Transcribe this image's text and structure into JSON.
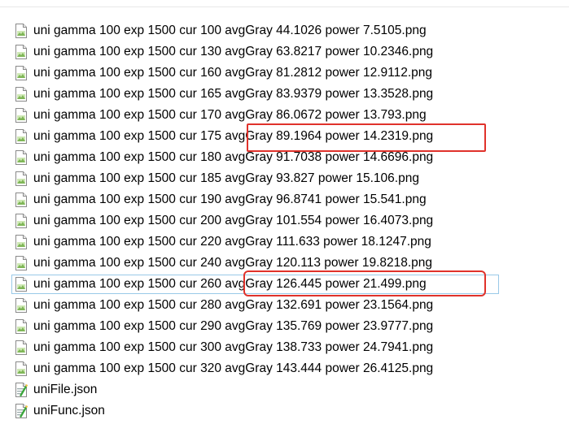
{
  "files": [
    {
      "name": "uni gamma 100 exp 1500 cur 100 avgGray 44.1026 power 7.5105.png",
      "icon": "png-file-icon"
    },
    {
      "name": "uni gamma 100 exp 1500 cur 130 avgGray 63.8217 power 10.2346.png",
      "icon": "png-file-icon"
    },
    {
      "name": "uni gamma 100 exp 1500 cur 160 avgGray 81.2812 power 12.9112.png",
      "icon": "png-file-icon"
    },
    {
      "name": "uni gamma 100 exp 1500 cur 165 avgGray 83.9379 power 13.3528.png",
      "icon": "png-file-icon"
    },
    {
      "name": "uni gamma 100 exp 1500 cur 170 avgGray 86.0672 power 13.793.png",
      "icon": "png-file-icon"
    },
    {
      "name": "uni gamma 100 exp 1500 cur 175 avgGray 89.1964 power 14.2319.png",
      "icon": "png-file-icon"
    },
    {
      "name": "uni gamma 100 exp 1500 cur 180 avgGray 91.7038 power 14.6696.png",
      "icon": "png-file-icon"
    },
    {
      "name": "uni gamma 100 exp 1500 cur 185 avgGray 93.827 power 15.106.png",
      "icon": "png-file-icon"
    },
    {
      "name": "uni gamma 100 exp 1500 cur 190 avgGray 96.8741 power 15.541.png",
      "icon": "png-file-icon"
    },
    {
      "name": "uni gamma 100 exp 1500 cur 200 avgGray 101.554 power 16.4073.png",
      "icon": "png-file-icon"
    },
    {
      "name": "uni gamma 100 exp 1500 cur 220 avgGray 111.633 power 18.1247.png",
      "icon": "png-file-icon"
    },
    {
      "name": "uni gamma 100 exp 1500 cur 240 avgGray 120.113 power 19.8218.png",
      "icon": "png-file-icon"
    },
    {
      "name": "uni gamma 100 exp 1500 cur 260 avgGray 126.445 power 21.499.png",
      "icon": "png-file-icon"
    },
    {
      "name": "uni gamma 100 exp 1500 cur 280 avgGray 132.691 power 23.1564.png",
      "icon": "png-file-icon"
    },
    {
      "name": "uni gamma 100 exp 1500 cur 290 avgGray 135.769 power 23.9777.png",
      "icon": "png-file-icon"
    },
    {
      "name": "uni gamma 100 exp 1500 cur 300 avgGray 138.733 power 24.7941.png",
      "icon": "png-file-icon"
    },
    {
      "name": "uni gamma 100 exp 1500 cur 320 avgGray 143.444 power 26.4125.png",
      "icon": "png-file-icon"
    },
    {
      "name": "uniFile.json",
      "icon": "json-file-icon"
    },
    {
      "name": "uniFunc.json",
      "icon": "json-file-icon"
    }
  ],
  "focused_item": "uni gamma 100 exp 1500 cur 260 avgGray 126.445 power 21.499.png",
  "highlight_color": "#e0322b"
}
